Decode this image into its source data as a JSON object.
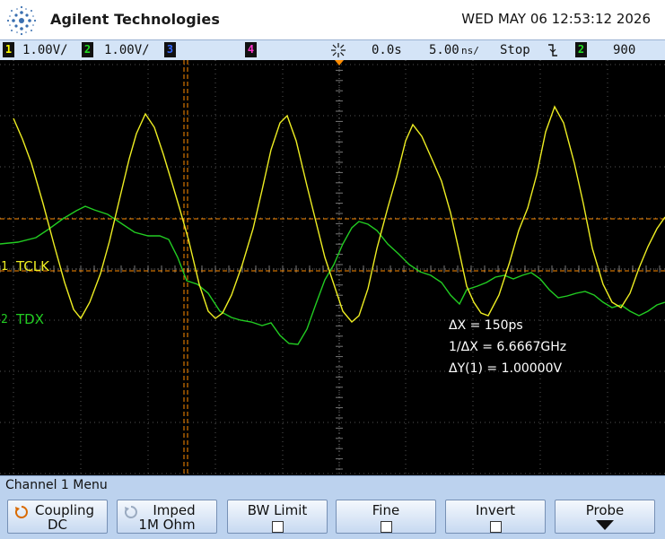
{
  "header": {
    "brand": "Agilent Technologies",
    "datetime": "WED MAY 06 12:53:12 2026"
  },
  "status": {
    "ch1_num": "1",
    "ch1_scale": "1.00V/",
    "ch2_num": "2",
    "ch2_scale": "1.00V/",
    "ch3_num": "3",
    "ch4_num": "4",
    "time_delay": "0.0s",
    "time_scale": "5.00",
    "time_unit": "ns/",
    "run_state": "Stop",
    "trigger_source": "2",
    "trigger_level": "900",
    "colors": {
      "ch1": "#ffff00",
      "ch2": "#22dd22",
      "ch3": "#3366ff",
      "ch4": "#ff33cc"
    }
  },
  "display": {
    "ch1_label": "TCLK",
    "ch2_label": "TDX",
    "ch1_marker": "1",
    "ch2_marker": "2",
    "measurements": {
      "dx": "ΔX = 150ps",
      "inv_dx": "1/ΔX = 6.6667GHz",
      "dy": "ΔY(1) = 1.00000V"
    }
  },
  "menu": {
    "title": "Channel 1  Menu",
    "softkeys": [
      {
        "label": "Coupling",
        "value": "DC"
      },
      {
        "label": "Imped",
        "value": "1M Ohm"
      },
      {
        "label": "BW Limit"
      },
      {
        "label": "Fine"
      },
      {
        "label": "Invert"
      },
      {
        "label": "Probe"
      }
    ]
  }
}
